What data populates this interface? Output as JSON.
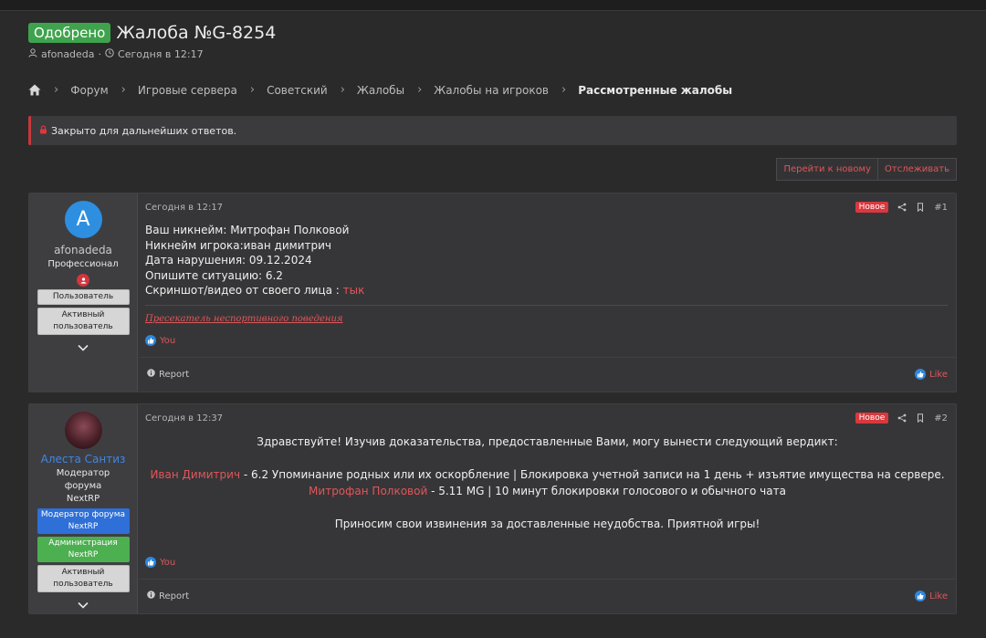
{
  "thread": {
    "status_badge": "Одобрено",
    "title": "Жалоба №G-8254",
    "author": "afonadeda",
    "date": "Сегодня в 12:17"
  },
  "breadcrumbs": [
    "Форум",
    "Игровые сервера",
    "Советский",
    "Жалобы",
    "Жалобы на игроков",
    "Рассмотренные жалобы"
  ],
  "notice": {
    "closed_text": "Закрыто для дальнейших ответов."
  },
  "actions": {
    "goto_new": "Перейти к новому",
    "watch": "Отслеживать"
  },
  "posts": [
    {
      "avatar_letter": "A",
      "username": "afonadeda",
      "user_title": "Профессионал",
      "banners": [
        "Пользователь",
        "Активный пользователь"
      ],
      "date": "Сегодня в 12:17",
      "new_badge": "Новое",
      "number": "#1",
      "lines": {
        "l1": "Ваш никнейм: Митрофан Полковой",
        "l2": "Никнейм игрока:иван димитрич",
        "l3": "Дата нарушения: 09.12.2024",
        "l4": "Опишите ситуацию: 6.2",
        "l5_prefix": "Скриншот/видео от своего лица : ",
        "l5_link": "тык"
      },
      "signature": "Пресекатель неспортивного поведения",
      "reaction_user": "You",
      "report": "Report",
      "like": "Like"
    },
    {
      "username": "Алеста Сантиз",
      "user_title": "Модератор форума NextRP",
      "banners": [
        "Модератор форума NextRP",
        "Администрация NextRP",
        "Активный пользователь"
      ],
      "date": "Сегодня в 12:37",
      "new_badge": "Новое",
      "number": "#2",
      "verdict": {
        "greeting": "Здравствуйте! Изучив доказательства, предоставленные Вами, могу вынести следующий вердикт:",
        "name1": "Иван Димитрич",
        "line1": " - 6.2 Упоминание родных или их оскорбление | Блокировка учетной записи на 1 день + изъятие имущества на сервере.",
        "name2": "Митрофан Полковой",
        "line2": " - 5.11 MG | 10 минут блокировки голосового и обычного чата",
        "closing": "Приносим свои извинения за доставленные неудобства. Приятной игры!"
      },
      "reaction_user": "You",
      "report": "Report",
      "like": "Like"
    }
  ]
}
